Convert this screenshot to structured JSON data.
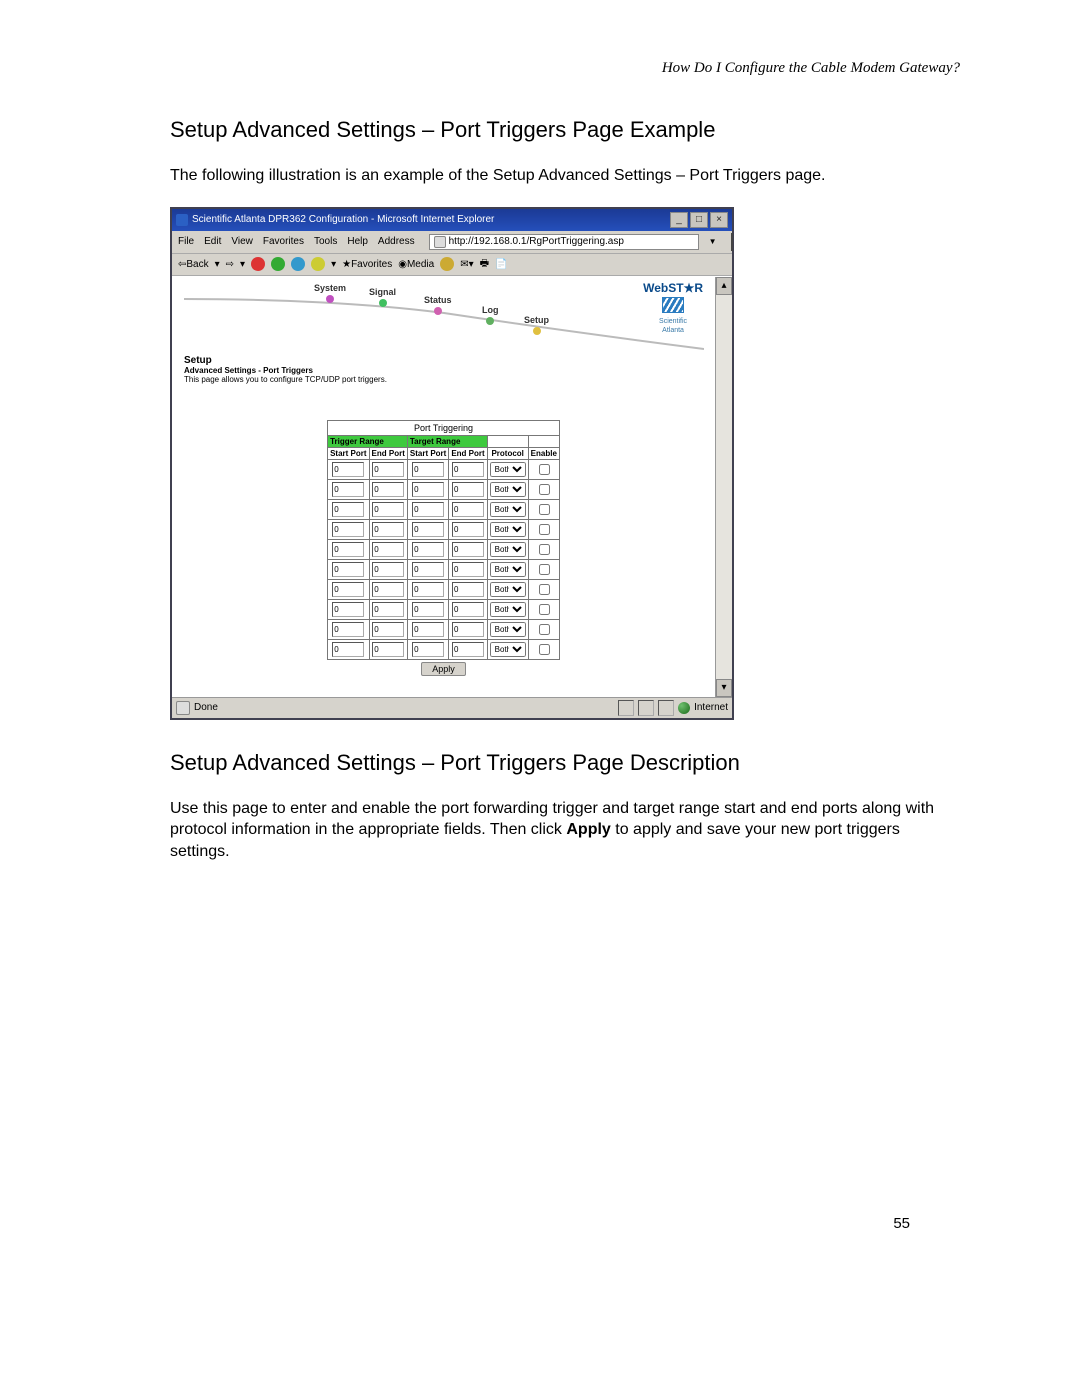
{
  "doc": {
    "header": "How Do I Configure the Cable Modem Gateway?",
    "h1_example": "Setup Advanced Settings – Port Triggers Page Example",
    "p_example": "The following illustration is an example of the Setup Advanced Settings – Port Triggers page.",
    "h1_desc": "Setup Advanced Settings – Port Triggers Page Description",
    "p_desc_pre": "Use this page to enter and enable the port forwarding trigger and target range start and end ports along with protocol information in the appropriate fields. Then click ",
    "p_desc_bold": "Apply",
    "p_desc_post": " to apply and save your new port triggers settings.",
    "page_number": "55"
  },
  "window": {
    "title": "Scientific Atlanta DPR362 Configuration - Microsoft Internet Explorer",
    "menus": [
      "File",
      "Edit",
      "View",
      "Favorites",
      "Tools",
      "Help"
    ],
    "address_label": "Address",
    "url": "http://192.168.0.1/RgPortTriggering.asp",
    "toolbar": {
      "back": "Back",
      "favorites": "Favorites",
      "media": "Media"
    },
    "nav": {
      "system": "System",
      "signal": "Signal",
      "status": "Status",
      "log": "Log",
      "setup": "Setup"
    },
    "logos": {
      "webstar": "WebST★R",
      "sa_line1": "Scientific",
      "sa_line2": "Atlanta"
    },
    "setup_block": {
      "title": "Setup",
      "sub": "Advanced Settings - Port Triggers",
      "desc": "This page allows you to configure TCP/UDP port triggers."
    },
    "table": {
      "caption": "Port Triggering",
      "trigger_range": "Trigger Range",
      "target_range": "Target Range",
      "cols": [
        "Start Port",
        "End Port",
        "Start Port",
        "End Port",
        "Protocol",
        "Enable"
      ],
      "protocol_option": "Both",
      "apply": "Apply",
      "default_value": "0",
      "row_count": 10
    },
    "status": {
      "done": "Done",
      "internet": "Internet"
    }
  }
}
